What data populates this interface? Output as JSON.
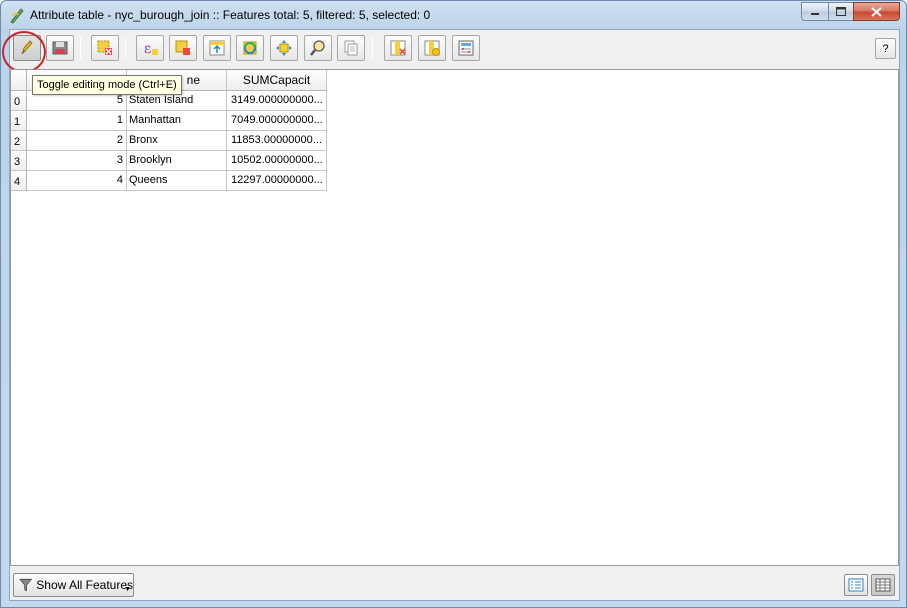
{
  "window": {
    "title": "Attribute table - nyc_burough_join :: Features total: 5, filtered: 5, selected: 0",
    "icons": {
      "app": "qgis-table-icon",
      "minimize": "minimize-icon",
      "maximize": "maximize-icon",
      "close": "close-icon"
    }
  },
  "toolbar": {
    "buttons": [
      {
        "name": "toggle-editing-button",
        "icon": "pencil-icon",
        "active": true
      },
      {
        "name": "save-edits-button",
        "icon": "save-icon"
      },
      {
        "name": "delete-selected-button",
        "icon": "delete-features-icon"
      },
      {
        "name": "select-by-expression-button",
        "icon": "expression-icon"
      },
      {
        "name": "unselect-all-button",
        "icon": "unselect-icon"
      },
      {
        "name": "move-selection-top-button",
        "icon": "move-top-icon"
      },
      {
        "name": "invert-selection-button",
        "icon": "invert-selection-icon"
      },
      {
        "name": "pan-to-selected-button",
        "icon": "pan-icon"
      },
      {
        "name": "zoom-to-selected-button",
        "icon": "zoom-icon"
      },
      {
        "name": "copy-selected-button",
        "icon": "copy-icon"
      },
      {
        "name": "delete-column-button",
        "icon": "delete-column-icon"
      },
      {
        "name": "new-column-button",
        "icon": "new-column-icon"
      },
      {
        "name": "field-calculator-button",
        "icon": "field-calculator-icon"
      }
    ],
    "help_label": "?"
  },
  "tooltip": {
    "text": "Toggle editing mode (Ctrl+E)"
  },
  "table": {
    "columns": [
      "",
      "ne",
      "SUMCapacit"
    ],
    "rows": [
      {
        "index": "0",
        "id": "5",
        "name": "Staten Island",
        "capacity": "3149.000000000..."
      },
      {
        "index": "1",
        "id": "1",
        "name": "Manhattan",
        "capacity": "7049.000000000..."
      },
      {
        "index": "2",
        "id": "2",
        "name": "Bronx",
        "capacity": "11853.00000000..."
      },
      {
        "index": "3",
        "id": "3",
        "name": "Brooklyn",
        "capacity": "10502.00000000..."
      },
      {
        "index": "4",
        "id": "4",
        "name": "Queens",
        "capacity": "12297.00000000..."
      }
    ]
  },
  "bottom": {
    "filter_label": "Show All Features",
    "filter_icon": "filter-icon",
    "view_buttons": [
      {
        "name": "form-view-button",
        "icon": "form-view-icon"
      },
      {
        "name": "table-view-button",
        "icon": "table-view-icon",
        "active": true
      }
    ]
  },
  "colors": {
    "highlight": "#c8262b",
    "tooltip_bg": "#ffffe1"
  }
}
